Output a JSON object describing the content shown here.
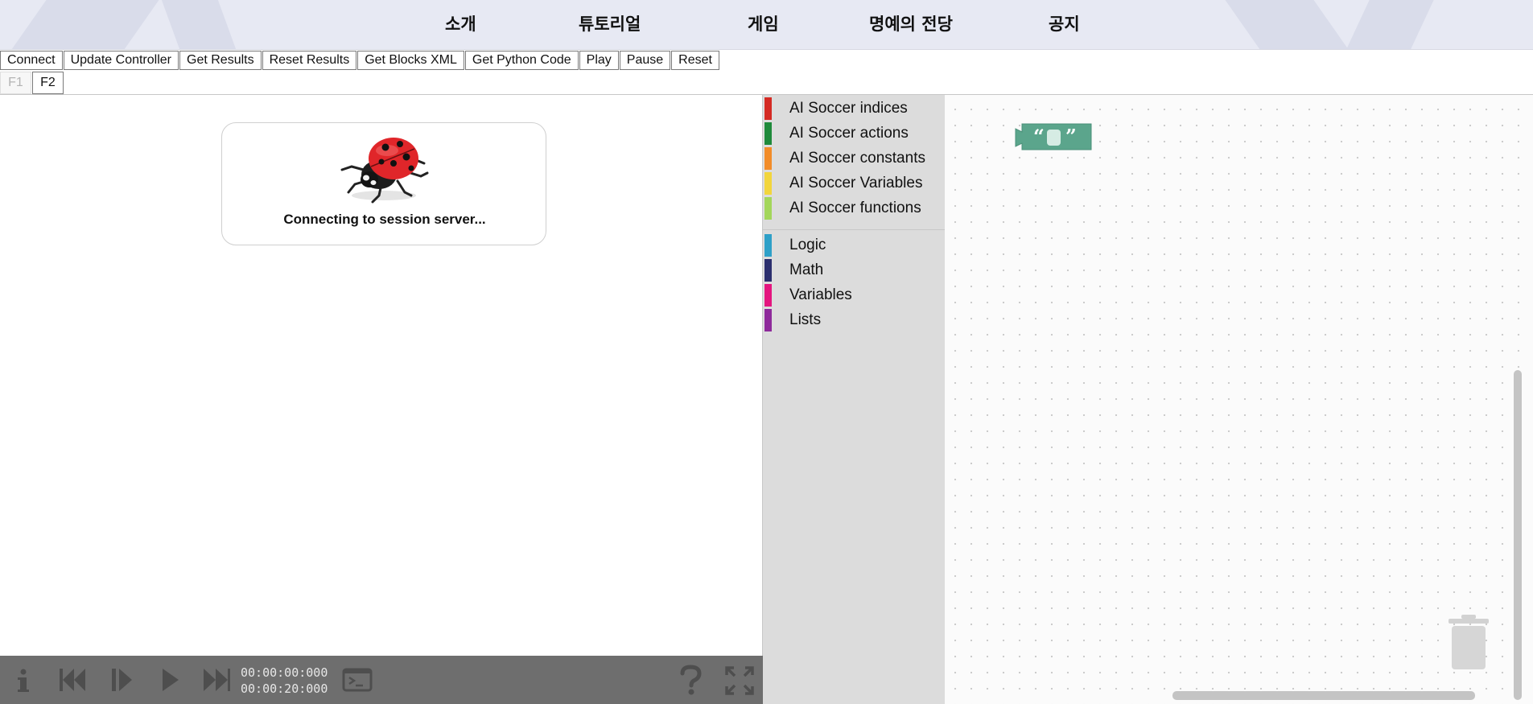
{
  "nav": {
    "items": [
      {
        "label": "소개"
      },
      {
        "label": "튜토리얼"
      },
      {
        "label": "게임"
      },
      {
        "label": "명예의 전당"
      },
      {
        "label": "공지"
      }
    ]
  },
  "toolbar": {
    "buttons": [
      {
        "label": "Connect"
      },
      {
        "label": "Update Controller"
      },
      {
        "label": "Get Results"
      },
      {
        "label": "Reset Results"
      },
      {
        "label": "Get Blocks XML"
      },
      {
        "label": "Get Python Code"
      },
      {
        "label": "Play"
      },
      {
        "label": "Pause"
      },
      {
        "label": "Reset"
      }
    ]
  },
  "tabs": [
    {
      "label": "F1",
      "disabled": true
    },
    {
      "label": "F2",
      "disabled": false
    }
  ],
  "simulator": {
    "status_text": "Connecting to session server..."
  },
  "player": {
    "time_current": "00:00:00:000",
    "time_total": "00:00:20:000",
    "icons": [
      "info-icon",
      "skip-back-icon",
      "step-icon",
      "play-icon",
      "fast-forward-icon",
      "console-icon",
      "help-icon",
      "fullscreen-icon"
    ]
  },
  "toolbox": {
    "categories": [
      {
        "label": "AI Soccer indices",
        "color": "#d42a23"
      },
      {
        "label": "AI Soccer actions",
        "color": "#1f8a3b"
      },
      {
        "label": "AI Soccer constants",
        "color": "#f28c28"
      },
      {
        "label": "AI Soccer Variables",
        "color": "#f2d53c"
      },
      {
        "label": "AI Soccer functions",
        "color": "#a3d65a"
      },
      {
        "label": "Logic",
        "color": "#2ea0c8"
      },
      {
        "label": "Math",
        "color": "#2c2f6e"
      },
      {
        "label": "Variables",
        "color": "#e4157f"
      },
      {
        "label": "Lists",
        "color": "#8e2a9b"
      }
    ]
  },
  "workspace": {
    "block_color": "#5ba58c",
    "block_icon": "text-string-block-icon",
    "trash_icon": "trash-icon"
  }
}
